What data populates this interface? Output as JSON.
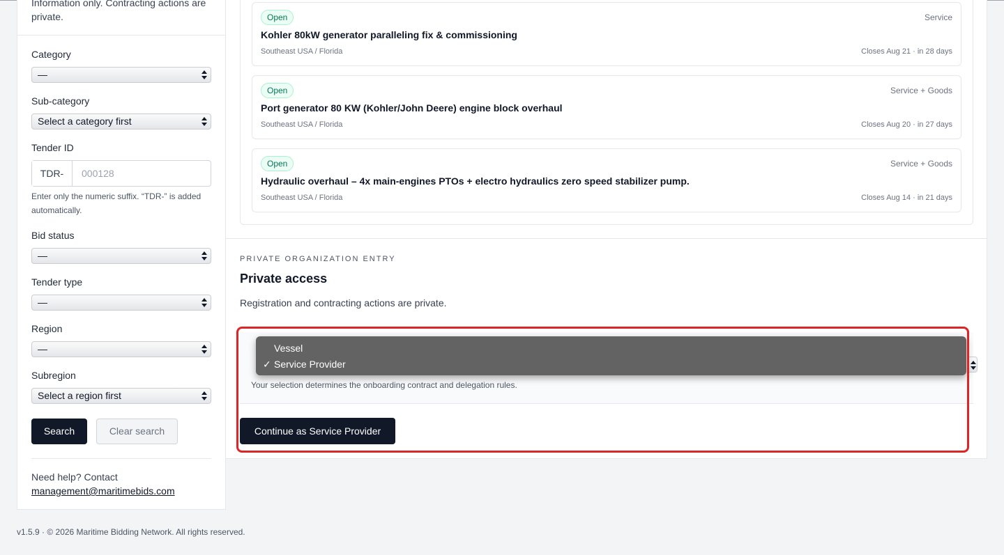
{
  "sidebar": {
    "intro": "Information only. Contracting actions are private.",
    "category": {
      "label": "Category",
      "value": "—"
    },
    "subcategory": {
      "label": "Sub-category",
      "value": "Select a category first"
    },
    "tender_id": {
      "label": "Tender ID",
      "prefix": "TDR-",
      "placeholder": "000128",
      "help": "Enter only the numeric suffix. “TDR-” is added automatically."
    },
    "bid_status": {
      "label": "Bid status",
      "value": "—"
    },
    "tender_type": {
      "label": "Tender type",
      "value": "—"
    },
    "region": {
      "label": "Region",
      "value": "—"
    },
    "subregion": {
      "label": "Subregion",
      "value": "Select a region first"
    },
    "search_label": "Search",
    "clear_label": "Clear search",
    "help_text": "Need help? Contact",
    "help_email": "management@maritimebids.com"
  },
  "tenders": [
    {
      "status": "Open",
      "type": "Service",
      "title": "Kohler 80kW generator paralleling fix & commissioning",
      "region": "Southeast USA / Florida",
      "closes": "Closes Aug 21 · in 28 days"
    },
    {
      "status": "Open",
      "type": "Service + Goods",
      "title": "Port generator 80 KW (Kohler/John Deere) engine block overhaul",
      "region": "Southeast USA / Florida",
      "closes": "Closes Aug 20 · in 27 days"
    },
    {
      "status": "Open",
      "type": "Service + Goods",
      "title": "Hydraulic overhaul – 4x main-engines PTOs + electro hydraulics zero speed stabilizer pump.",
      "region": "Southeast USA / Florida",
      "closes": "Closes Aug 14 · in 21 days"
    }
  ],
  "private": {
    "eyebrow": "PRIVATE ORGANIZATION ENTRY",
    "title": "Private access",
    "description": "Registration and contracting actions are private.",
    "options": [
      "Vessel",
      "Service Provider"
    ],
    "selected_mark": "✓",
    "selected": "Service Provider",
    "hint": "Your selection determines the onboarding contract and delegation rules.",
    "continue_label": "Continue as Service Provider"
  },
  "footer": "v1.5.9 · © 2026 Maritime Bidding Network. All rights reserved.",
  "colors": {
    "primary": "#111827",
    "badge_green": "#047857",
    "highlight": "#dc2626",
    "dropdown_bg": "#636363"
  }
}
